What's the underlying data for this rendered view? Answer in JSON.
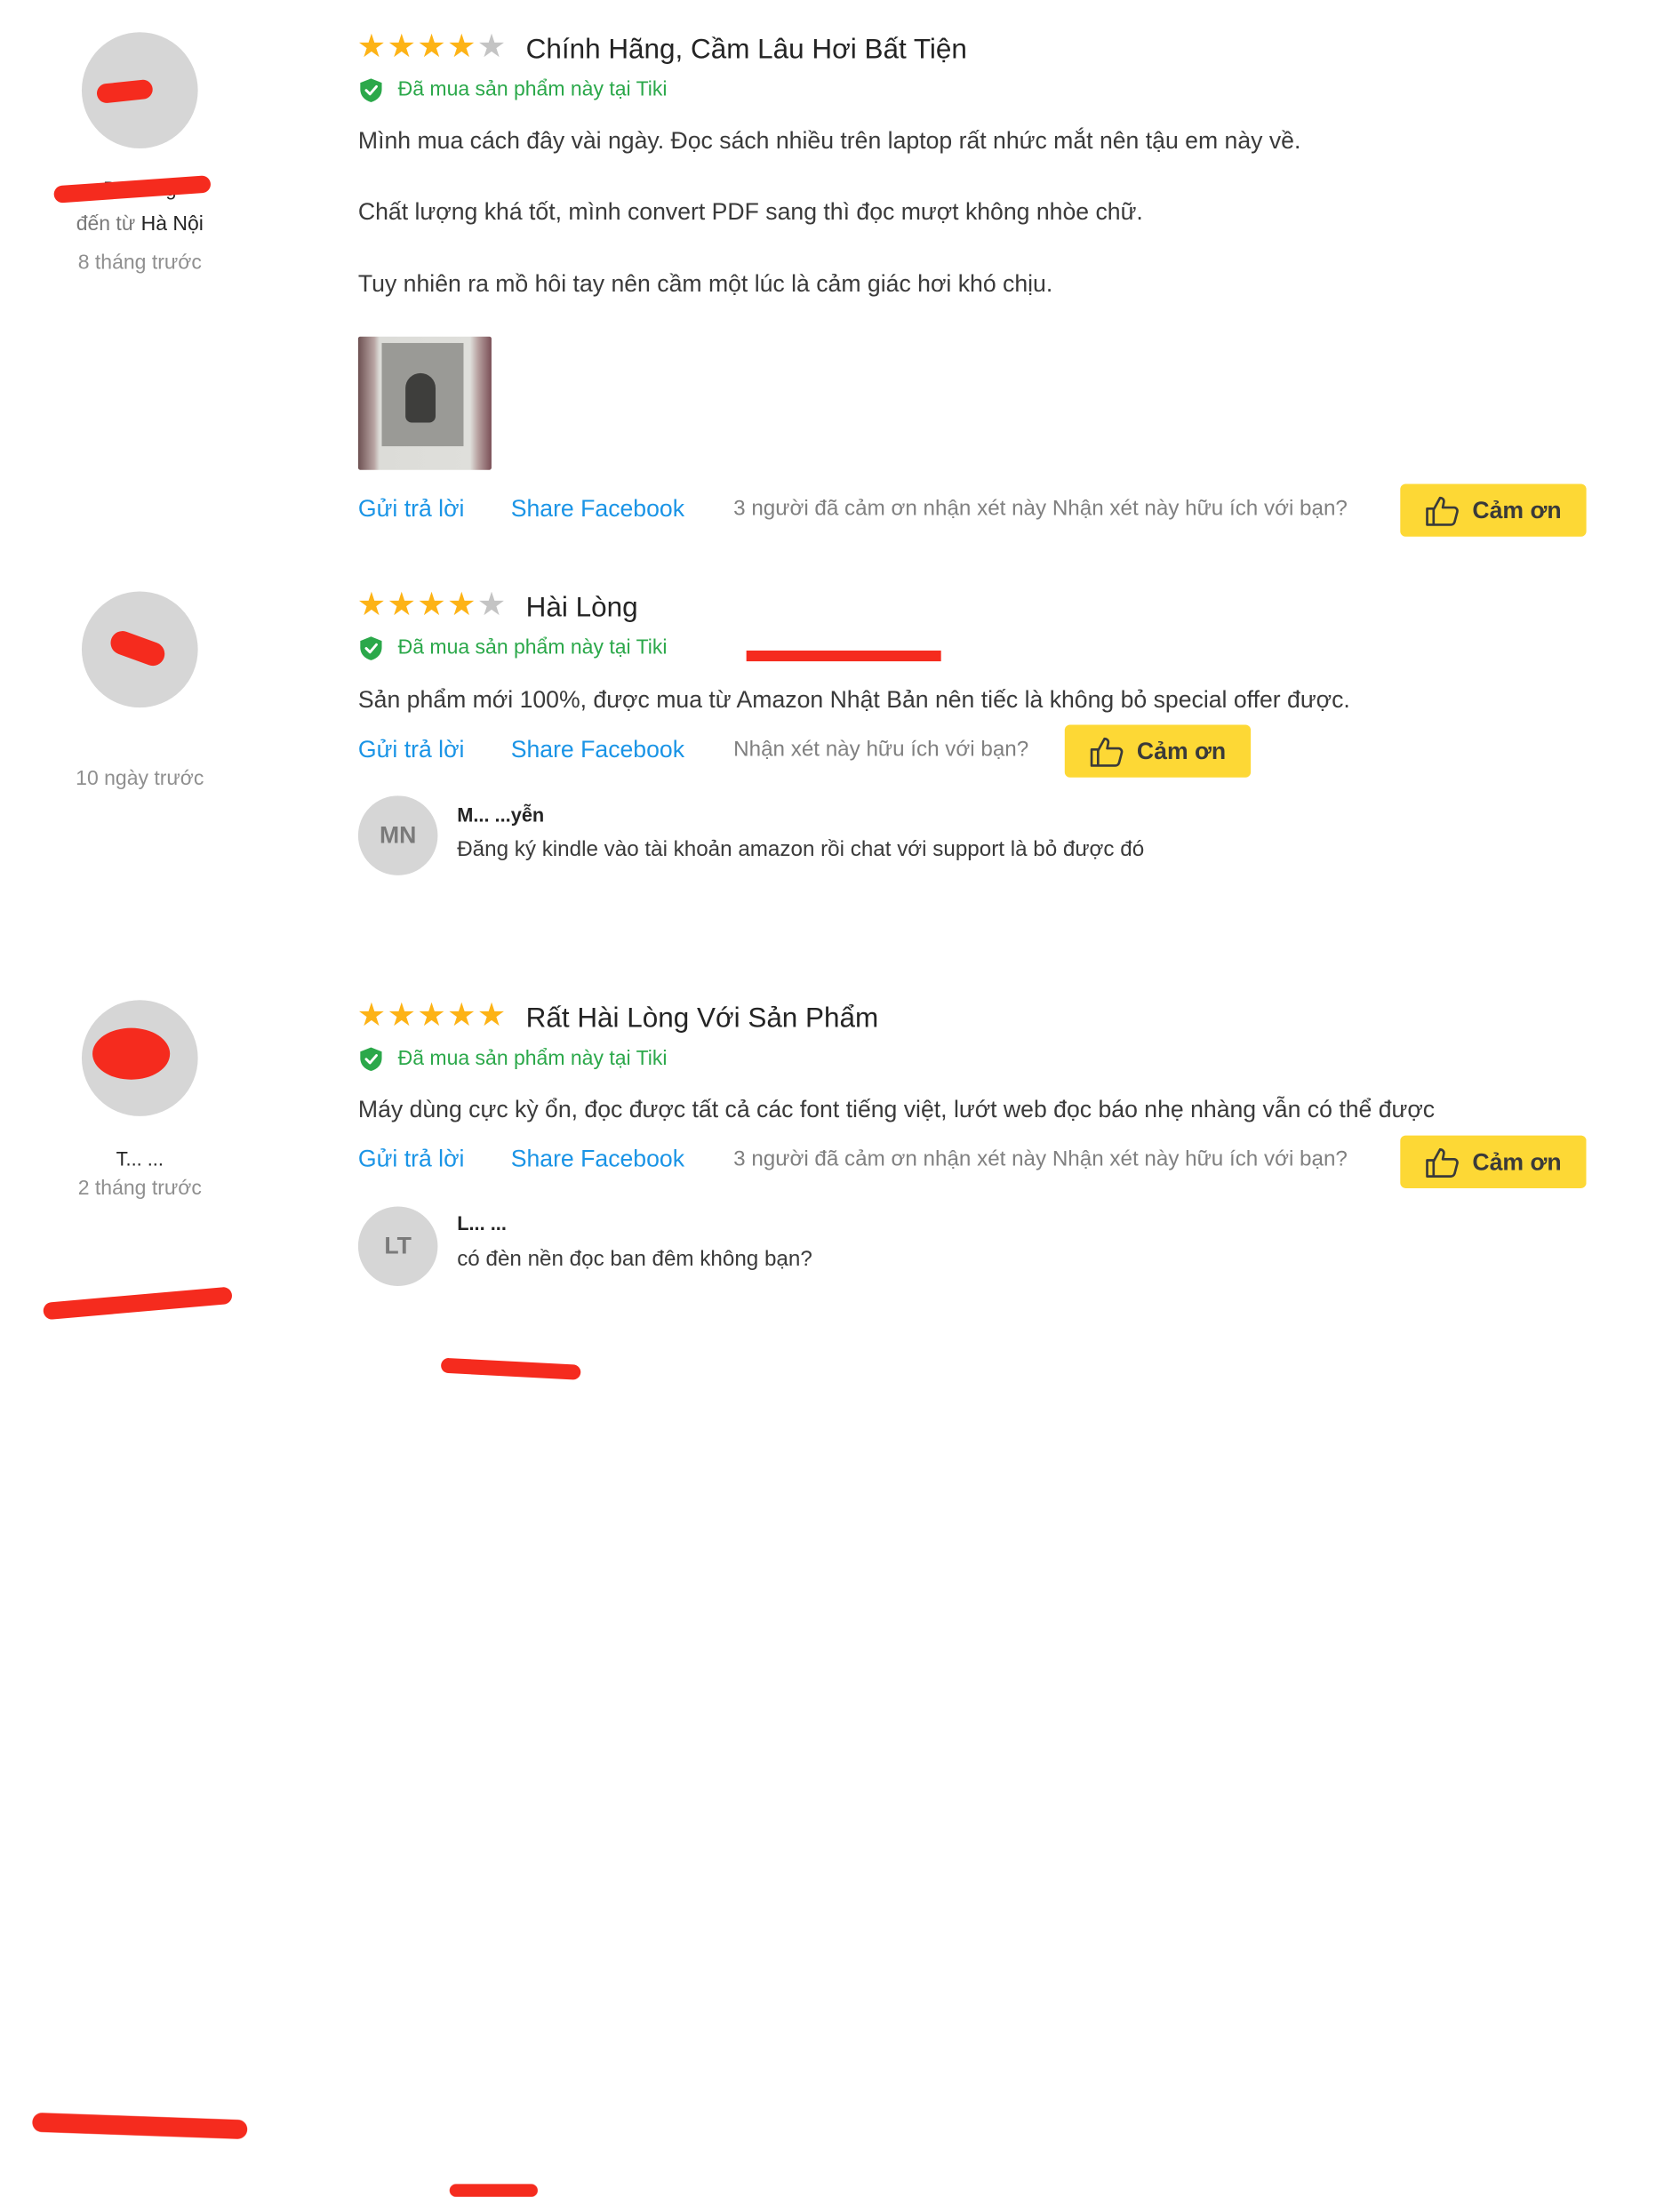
{
  "reviews": [
    {
      "rating": 4,
      "title": "Chính Hãng, Cầm Lâu Hơi Bất Tiện",
      "verified": "Đã mua sản phẩm này tại Tiki",
      "author_name": "D... ...ng",
      "city_prefix": "đến từ",
      "city": "Hà Nội",
      "time_ago": "8 tháng trước",
      "paragraphs": [
        "Mình mua cách đây vài ngày. Đọc sách nhiều trên laptop rất nhức mắt nên tậu em này về.",
        "Chất lượng khá tốt, mình convert PDF sang thì đọc mượt không nhòe chữ.",
        "Tuy nhiên ra mồ hôi tay nên cầm một lúc là cảm giác hơi khó chịu."
      ],
      "reply_link": "Gửi trả lời",
      "share_link": "Share Facebook",
      "helpful_text": "3 người đã cảm ơn nhận xét này Nhận xét này hữu ích với bạn?",
      "thanks_label": "Cảm ơn"
    },
    {
      "rating": 4,
      "title": "Hài Lòng",
      "verified": "Đã mua sản phẩm này tại Tiki",
      "time_ago": "10 ngày trước",
      "paragraphs": [
        "Sản phẩm mới 100%, được mua từ Amazon Nhật Bản nên tiếc là không bỏ special offer được."
      ],
      "reply_link": "Gửi trả lời",
      "share_link": "Share Facebook",
      "helpful_text": "Nhận xét này hữu ích với bạn?",
      "thanks_label": "Cảm ơn",
      "reply": {
        "initials": "MN",
        "name": "M... ...yễn",
        "text": "Đăng ký kindle vào tài khoản amazon rồi chat với support là bỏ được đó"
      }
    },
    {
      "rating": 5,
      "title": "Rất Hài Lòng Với Sản Phẩm",
      "verified": "Đã mua sản phẩm này tại Tiki",
      "author_name": "T... ...",
      "time_ago": "2 tháng trước",
      "paragraphs": [
        "Máy dùng cực kỳ ổn, đọc được tất cả các font tiếng việt, lướt web đọc báo nhẹ nhàng vẫn có thể được"
      ],
      "reply_link": "Gửi trả lời",
      "share_link": "Share Facebook",
      "helpful_text": "3 người đã cảm ơn nhận xét này Nhận xét này hữu ích với bạn?",
      "thanks_label": "Cảm ơn",
      "reply": {
        "initials": "LT",
        "name": "L... ...",
        "text": "có đèn nền đọc ban đêm không bạn?"
      }
    }
  ],
  "colors": {
    "star": "#fdb316",
    "star_off": "#c4c4c4",
    "verified": "#2ba84a",
    "link": "#1a94e6",
    "button": "#fdd835",
    "redaction": "#f52b1e"
  },
  "icons": {
    "star": "star-icon",
    "shield": "shield-check-icon",
    "thumb": "thumbs-up-icon"
  }
}
